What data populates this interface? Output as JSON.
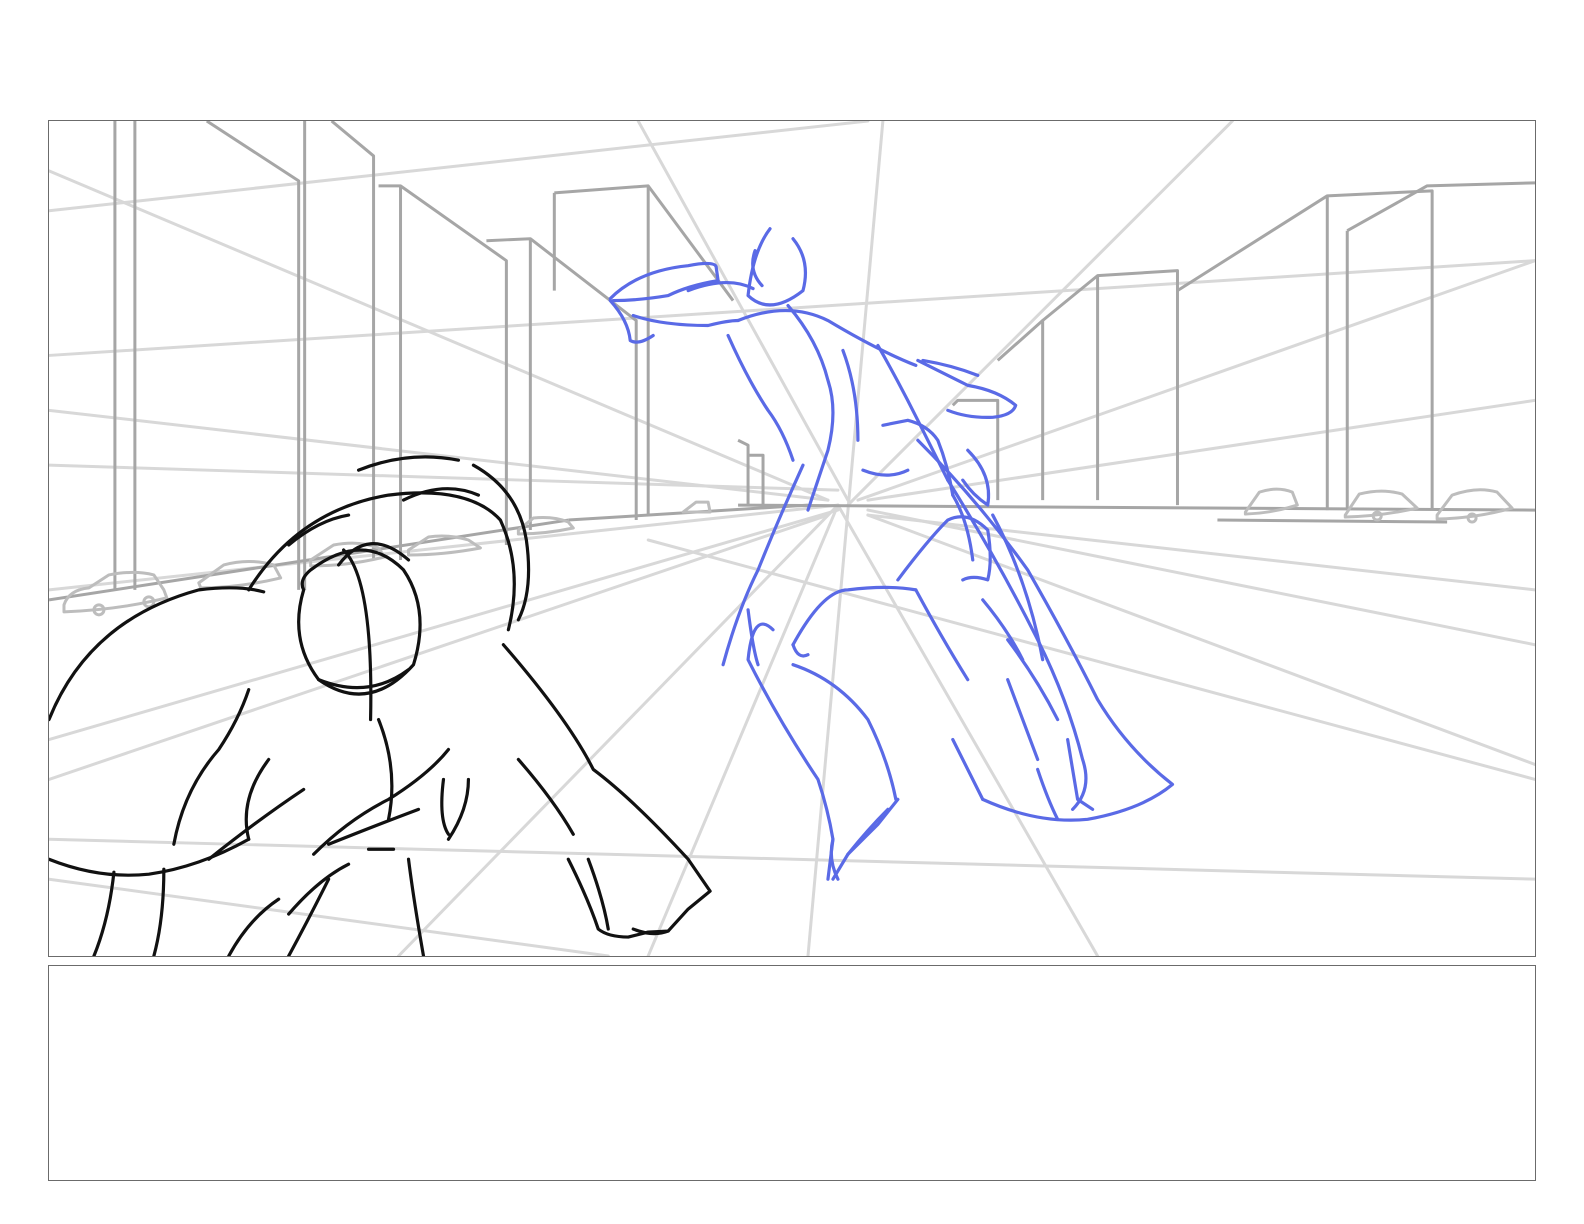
{
  "storyboard": {
    "panel_label": "",
    "notes_text": "",
    "colors": {
      "border": "#6b6b6b",
      "perspective": "#d6d6d6",
      "buildings": "#a6a6a6",
      "cars": "#bdbdbd",
      "foreground_figure": "#111111",
      "background_figure": "#5a6ae6"
    }
  }
}
